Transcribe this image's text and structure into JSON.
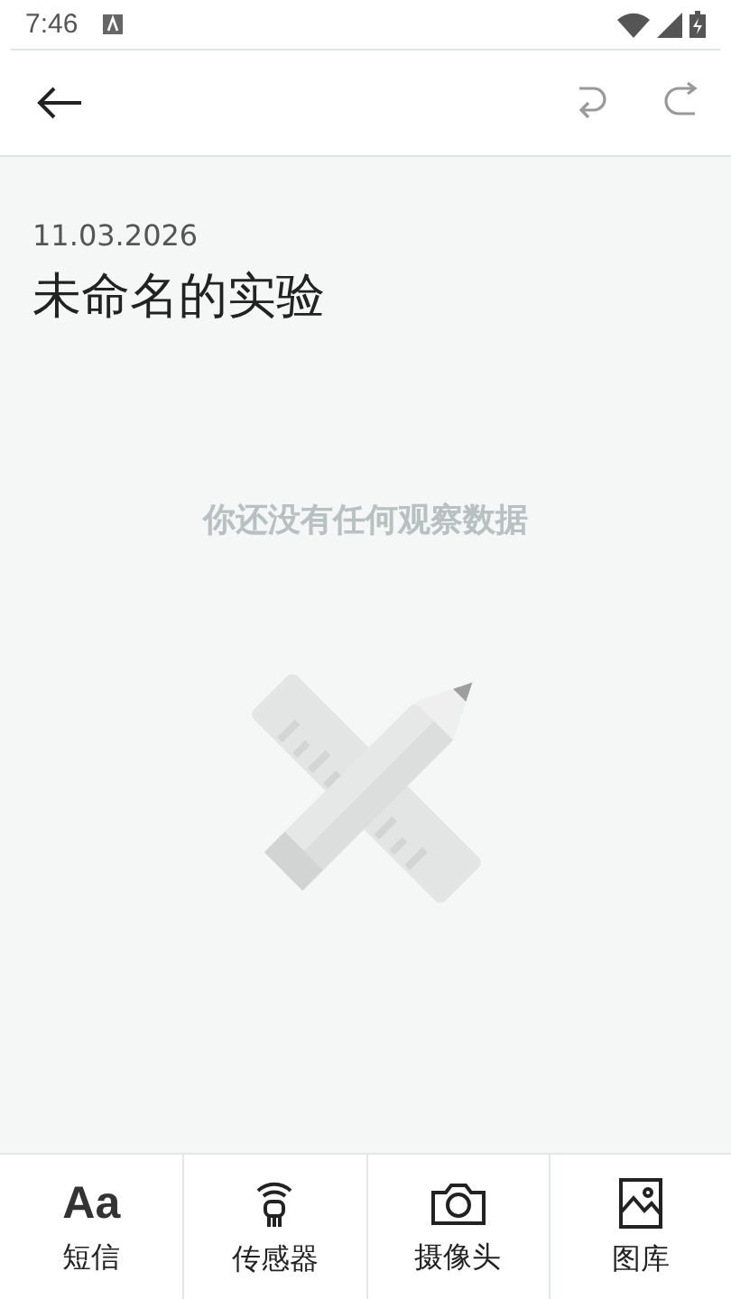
{
  "status_bar": {
    "time": "7:46"
  },
  "experiment": {
    "date": "11.03.2026",
    "title": "未命名的实验",
    "empty_message": "你还没有任何观察数据"
  },
  "bottom_tabs": [
    {
      "kind": "text",
      "icon_text": "Aa",
      "label": "短信"
    },
    {
      "kind": "sensor",
      "label": "传感器"
    },
    {
      "kind": "camera",
      "label": "摄像头"
    },
    {
      "kind": "gallery",
      "label": "图库"
    }
  ]
}
